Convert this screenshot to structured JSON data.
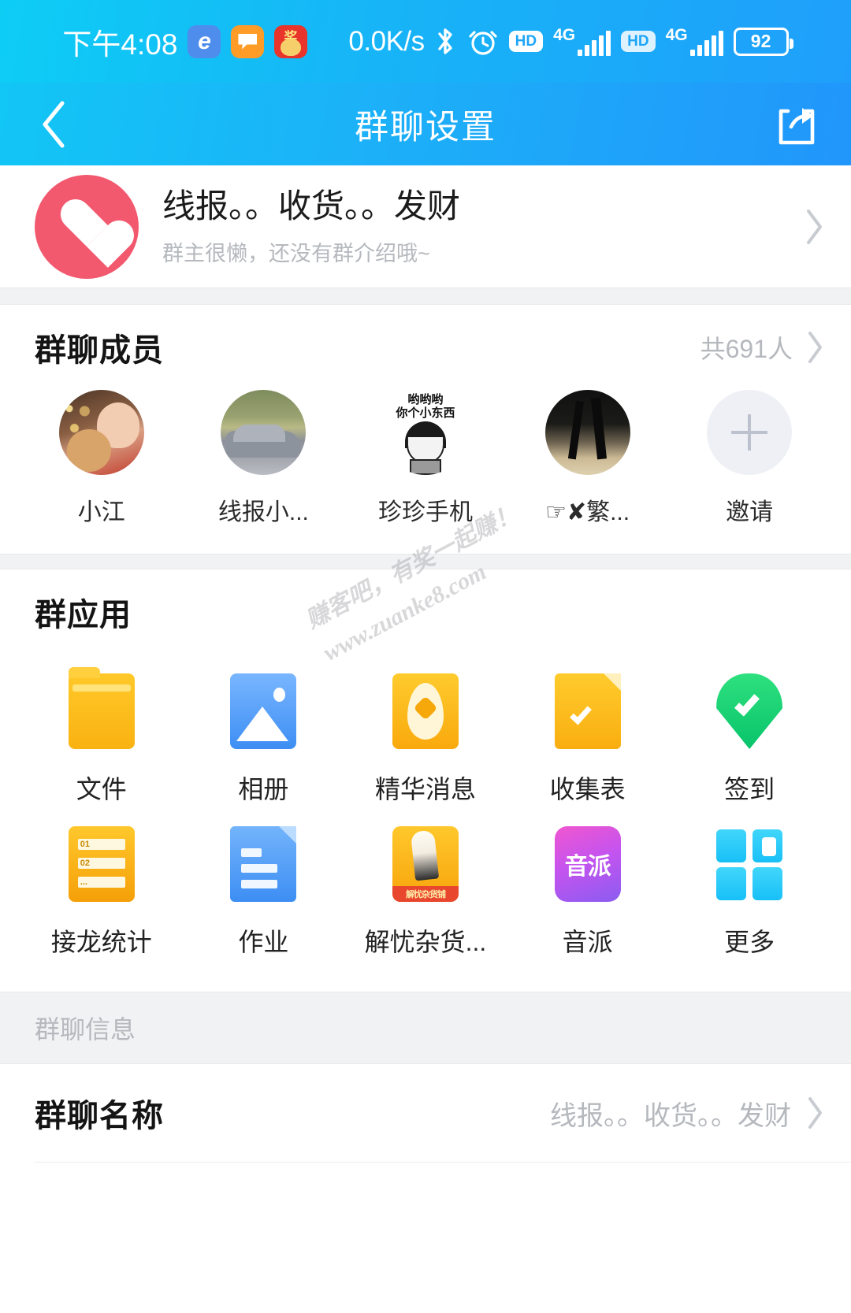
{
  "statusbar": {
    "time": "下午4:08",
    "network_speed": "0.0K/s",
    "battery_level": "92",
    "tray_icons": [
      "browser-e-icon",
      "note-orange-icon",
      "promo-red-icon"
    ],
    "signal_labels": [
      "4G",
      "4G"
    ],
    "hd_labels": [
      "HD",
      "HD"
    ],
    "bluetooth_icon": "bluetooth-icon",
    "alarm_icon": "alarm-icon"
  },
  "titlebar": {
    "back_icon": "chevron-left-icon",
    "title": "群聊设置",
    "share_icon": "share-icon"
  },
  "group_header": {
    "avatar_icon": "heart-avatar",
    "name": "线报。。收货。。发财",
    "description": "群主很懒，还没有群介绍哦~",
    "chevron_icon": "chevron-right-icon"
  },
  "members_section": {
    "title": "群聊成员",
    "count_label": "共691人",
    "chevron_icon": "chevron-right-icon",
    "members": [
      {
        "name": "小江",
        "avatar": "girl-with-dog-photo"
      },
      {
        "name": "线报小...",
        "avatar": "car-photo"
      },
      {
        "name": "珍珍手机",
        "avatar": "meme-sticker"
      },
      {
        "name": "☞✘繁...",
        "avatar": "silhouette-photo"
      },
      {
        "name": "邀请",
        "avatar": "plus-icon"
      }
    ]
  },
  "apps_section": {
    "title": "群应用",
    "apps": [
      {
        "label": "文件",
        "icon": "folder-icon"
      },
      {
        "label": "相册",
        "icon": "album-icon"
      },
      {
        "label": "精华消息",
        "icon": "essence-icon"
      },
      {
        "label": "收集表",
        "icon": "collect-form-icon"
      },
      {
        "label": "签到",
        "icon": "check-in-icon"
      },
      {
        "label": "接龙统计",
        "icon": "relay-stats-icon"
      },
      {
        "label": "作业",
        "icon": "homework-icon"
      },
      {
        "label": "解忧杂货...",
        "icon": "grocery-shop-icon"
      },
      {
        "label": "音派",
        "icon": "music-icon"
      },
      {
        "label": "更多",
        "icon": "more-grid-icon"
      }
    ]
  },
  "info_section": {
    "band_label": "群聊信息",
    "rows": [
      {
        "label": "群聊名称",
        "value": "线报。。收货。。发财",
        "chevron_icon": "chevron-right-icon"
      }
    ]
  },
  "watermark": {
    "line1": "赚客吧，有奖一起赚！",
    "line2": "www.zuanke8.com"
  },
  "colors": {
    "header_blue": "#17b4f7",
    "accent_avatar": "#f2586e",
    "muted_text": "#b5b8bd",
    "band": "#f1f2f4"
  }
}
